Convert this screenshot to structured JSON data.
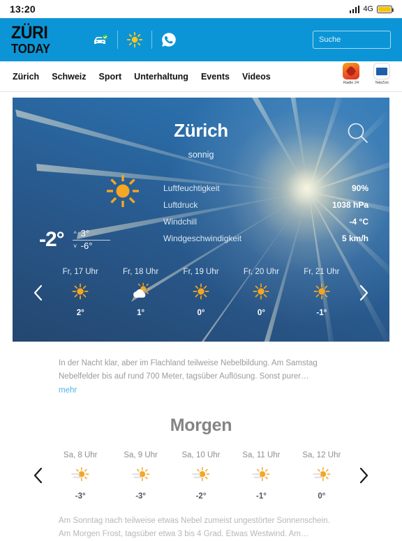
{
  "statusbar": {
    "time": "13:20",
    "network": "4G",
    "signal_icon": "signal-bars-icon",
    "battery_icon": "battery-icon",
    "battery_color": "#fcc200"
  },
  "header": {
    "logo_line1": "ZÜRI",
    "logo_line2": "TODAY",
    "brand_color": "#0c95d6",
    "icons": [
      {
        "name": "traffic-car-icon",
        "label": "Verkehr"
      },
      {
        "name": "sun-weather-icon",
        "label": "Wetter"
      },
      {
        "name": "whatsapp-icon",
        "label": "WhatsApp"
      }
    ],
    "search": {
      "placeholder": "Suche",
      "value": "",
      "icon": "search-icon"
    }
  },
  "nav": {
    "items": [
      {
        "label": "Zürich"
      },
      {
        "label": "Schweiz"
      },
      {
        "label": "Sport"
      },
      {
        "label": "Unterhaltung"
      },
      {
        "label": "Events"
      },
      {
        "label": "Videos"
      }
    ],
    "apps": [
      {
        "label": "Radio 24",
        "icon": "radio24-app-icon"
      },
      {
        "label": "TeleZüri",
        "icon": "telezueri-app-icon"
      }
    ]
  },
  "weather": {
    "city": "Zürich",
    "condition": "sonnig",
    "search_icon": "search-icon",
    "condition_icon": "sun-icon",
    "current_temp": "-2°",
    "temp_max": "3°",
    "temp_min": "-6°",
    "details": [
      {
        "label": "Luftfeuchtigkeit",
        "value": "90%"
      },
      {
        "label": "Luftdruck",
        "value": "1038 hPa"
      },
      {
        "label": "Windchill",
        "value": "-4 °C"
      },
      {
        "label": "Windgeschwindigkeit",
        "value": "5 km/h"
      }
    ],
    "prev_label": "‹",
    "next_label": "›",
    "hourly": [
      {
        "time": "Fr, 17 Uhr",
        "icon": "sun-icon",
        "temp": "2°"
      },
      {
        "time": "Fr, 18 Uhr",
        "icon": "sun-cloud-icon",
        "temp": "1°"
      },
      {
        "time": "Fr, 19 Uhr",
        "icon": "sun-icon",
        "temp": "0°"
      },
      {
        "time": "Fr, 20 Uhr",
        "icon": "sun-icon",
        "temp": "0°"
      },
      {
        "time": "Fr, 21 Uhr",
        "icon": "sun-icon",
        "temp": "-1°"
      }
    ],
    "description": "In der Nacht klar, aber im Flachland teilweise Nebelbildung. Am Samstag Nebelfelder bis auf rund 700 Meter, tagsüber Auflösung. Sonst purer…",
    "more_link": "mehr"
  },
  "tomorrow": {
    "title": "Morgen",
    "prev_label": "‹",
    "next_label": "›",
    "hourly": [
      {
        "time": "Sa, 8 Uhr",
        "icon": "sun-haze-icon",
        "temp": "-3°"
      },
      {
        "time": "Sa, 9 Uhr",
        "icon": "sun-haze-icon",
        "temp": "-3°"
      },
      {
        "time": "Sa, 10 Uhr",
        "icon": "sun-haze-icon",
        "temp": "-2°"
      },
      {
        "time": "Sa, 11 Uhr",
        "icon": "sun-haze-icon",
        "temp": "-1°"
      },
      {
        "time": "Sa, 12 Uhr",
        "icon": "sun-haze-icon",
        "temp": "0°"
      }
    ],
    "description": "Am Sonntag nach teilweise etwas Nebel zumeist ungestörter Sonnenschein. Am Morgen Frost, tagsüber etwa 3 bis 4 Grad. Etwas Westwind. Am…"
  },
  "colors": {
    "accent": "#0c95d6",
    "sun": "#f5a623",
    "link": "#4db3e8"
  }
}
